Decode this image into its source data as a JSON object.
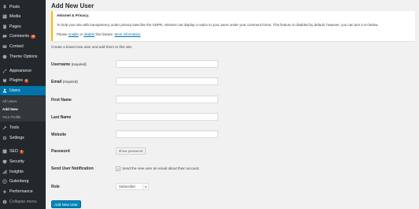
{
  "sidebar": {
    "items": [
      {
        "label": "Posts",
        "icon": "pin-icon",
        "badge": ""
      },
      {
        "label": "Media",
        "icon": "media-icon",
        "badge": ""
      },
      {
        "label": "Pages",
        "icon": "page-icon",
        "badge": ""
      },
      {
        "label": "Comments",
        "icon": "comment-icon",
        "badge": "15"
      },
      {
        "label": "Contact",
        "icon": "mail-icon",
        "badge": ""
      },
      {
        "label": "Theme Options",
        "icon": "theme-icon",
        "badge": ""
      },
      {
        "label": "Appearance",
        "icon": "brush-icon",
        "badge": ""
      },
      {
        "label": "Plugins",
        "icon": "plugin-icon",
        "badge": "4"
      },
      {
        "label": "Users",
        "icon": "users-icon",
        "badge": ""
      },
      {
        "label": "Tools",
        "icon": "wrench-icon",
        "badge": ""
      },
      {
        "label": "Settings",
        "icon": "settings-icon",
        "badge": ""
      },
      {
        "label": "SEO",
        "icon": "seo-icon",
        "badge": "1"
      },
      {
        "label": "Security",
        "icon": "shield-icon",
        "badge": ""
      },
      {
        "label": "Insights",
        "icon": "insights-icon",
        "badge": ""
      },
      {
        "label": "Gutenberg",
        "icon": "gutenberg-icon",
        "badge": ""
      },
      {
        "label": "Performance",
        "icon": "performance-icon",
        "badge": ""
      }
    ],
    "submenu": [
      "All Users",
      "Add New",
      "Your Profile"
    ],
    "collapse_label": "Collapse menu"
  },
  "page": {
    "title": "Add New User",
    "notice": {
      "title": "Akismet & Privacy.",
      "text": "To help your site with transparency under privacy laws like the GDPR, Akismet can display a notice to your users under your comment forms. This feature is disabled by default, however, you can turn it on below.",
      "links_prefix": "Please ",
      "enable": "enable",
      "or": " or ",
      "disable": "disable",
      "links_suffix": " this feature. ",
      "more_info": "More information"
    },
    "intro": "Create a brand new user and add them to this site."
  },
  "form": {
    "username_label": "Username",
    "username_req": "(required)",
    "email_label": "Email",
    "email_req": "(required)",
    "firstname_label": "First Name",
    "lastname_label": "Last Name",
    "website_label": "Website",
    "password_label": "Password",
    "show_password": "Show password",
    "notification_label": "Send User Notification",
    "notification_text": "Send the new user an email about their account.",
    "notification_checked": true,
    "role_label": "Role",
    "role_value": "Subscriber",
    "submit": "Add New User"
  },
  "colors": {
    "sidebar_bg": "#23282d",
    "accent": "#0073aa",
    "primary_button": "#0085ba",
    "notice_border": "#ffb900",
    "badge": "#d54e21"
  }
}
